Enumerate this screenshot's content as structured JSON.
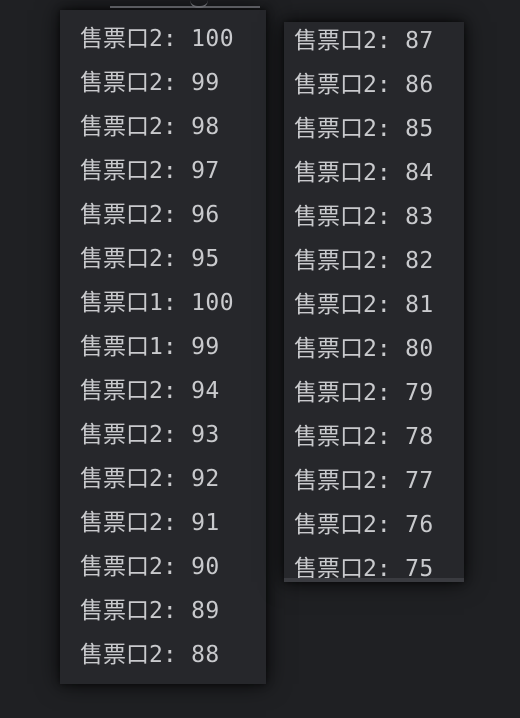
{
  "console": {
    "left_column": [
      {
        "label": "售票口2:",
        "value": "100"
      },
      {
        "label": "售票口2:",
        "value": "99"
      },
      {
        "label": "售票口2:",
        "value": "98"
      },
      {
        "label": "售票口2:",
        "value": "97"
      },
      {
        "label": "售票口2:",
        "value": "96"
      },
      {
        "label": "售票口2:",
        "value": "95"
      },
      {
        "label": "售票口1:",
        "value": "100"
      },
      {
        "label": "售票口1:",
        "value": "99"
      },
      {
        "label": "售票口2:",
        "value": "94"
      },
      {
        "label": "售票口2:",
        "value": "93"
      },
      {
        "label": "售票口2:",
        "value": "92"
      },
      {
        "label": "售票口2:",
        "value": "91"
      },
      {
        "label": "售票口2:",
        "value": "90"
      },
      {
        "label": "售票口2:",
        "value": "89"
      },
      {
        "label": "售票口2:",
        "value": "88"
      }
    ],
    "right_column": [
      {
        "label": "售票口2:",
        "value": "87"
      },
      {
        "label": "售票口2:",
        "value": "86"
      },
      {
        "label": "售票口2:",
        "value": "85"
      },
      {
        "label": "售票口2:",
        "value": "84"
      },
      {
        "label": "售票口2:",
        "value": "83"
      },
      {
        "label": "售票口2:",
        "value": "82"
      },
      {
        "label": "售票口2:",
        "value": "81"
      },
      {
        "label": "售票口2:",
        "value": "80"
      },
      {
        "label": "售票口2:",
        "value": "79"
      },
      {
        "label": "售票口2:",
        "value": "78"
      },
      {
        "label": "售票口2:",
        "value": "77"
      },
      {
        "label": "售票口2:",
        "value": "76"
      },
      {
        "label": "售票口2:",
        "value": "75"
      }
    ]
  },
  "colors": {
    "background": "#1f2023",
    "panel": "#26272b",
    "text": "#c9cacd"
  }
}
